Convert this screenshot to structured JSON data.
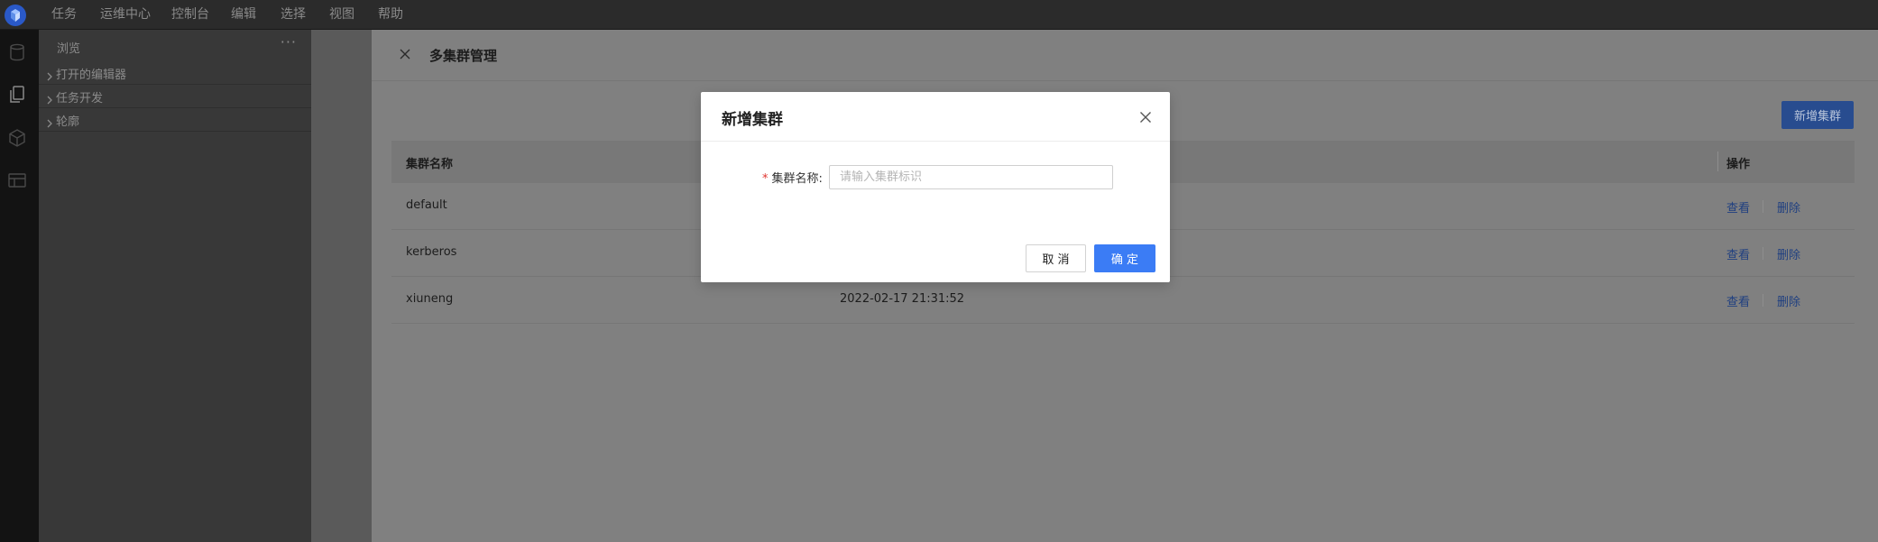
{
  "menubar": {
    "items": [
      "任务",
      "运维中心",
      "控制台",
      "编辑",
      "选择",
      "视图",
      "帮助"
    ]
  },
  "activity_bar": {
    "icons": [
      "database-icon",
      "files-icon",
      "cube-icon",
      "table-icon"
    ]
  },
  "sidebar": {
    "title": "浏览",
    "more": "···",
    "items": [
      {
        "label": "打开的编辑器"
      },
      {
        "label": "任务开发"
      },
      {
        "label": "轮廓"
      }
    ]
  },
  "page": {
    "title": "多集群管理",
    "add_button": "新增集群",
    "table": {
      "columns": [
        "集群名称",
        "操作"
      ],
      "rows": [
        {
          "name": "default",
          "time": "",
          "view": "查看",
          "delete": "删除"
        },
        {
          "name": "kerberos",
          "time": "",
          "view": "查看",
          "delete": "删除"
        },
        {
          "name": "xiuneng",
          "time": "2022-02-17 21:31:52",
          "view": "查看",
          "delete": "删除"
        }
      ]
    }
  },
  "modal": {
    "title": "新增集群",
    "field_label": "集群名称:",
    "required_mark": "*",
    "field_value": "",
    "field_placeholder": "请输入集群标识",
    "cancel_label": "取 消",
    "ok_label": "确 定"
  },
  "colors": {
    "primary": "#3b7cf5",
    "required": "#e0342f",
    "menubar_bg": "#2b2b2b",
    "sidebar_bg": "#383838"
  }
}
